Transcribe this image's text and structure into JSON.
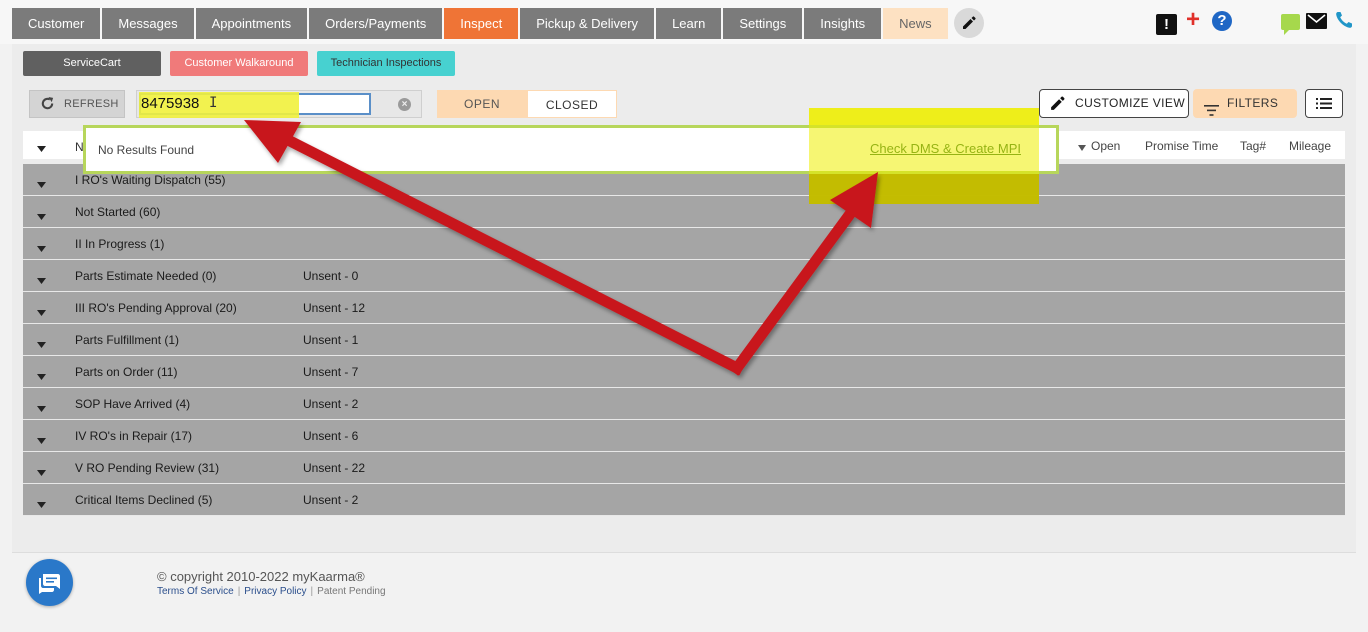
{
  "nav": {
    "tabs": [
      {
        "label": "Customer"
      },
      {
        "label": "Messages"
      },
      {
        "label": "Appointments"
      },
      {
        "label": "Orders/Payments"
      },
      {
        "label": "Inspect"
      },
      {
        "label": "Pickup & Delivery"
      },
      {
        "label": "Learn"
      },
      {
        "label": "Settings"
      },
      {
        "label": "Insights"
      },
      {
        "label": "News"
      }
    ],
    "active_tab": "Inspect",
    "alert_glyph": "!",
    "plus_glyph": "+",
    "help_glyph": "?"
  },
  "subtabs": {
    "service_cart": "ServiceCart",
    "customer_walkaround": "Customer Walkaround",
    "technician_inspections": "Technician Inspections"
  },
  "toolbar": {
    "refresh_label": "REFRESH",
    "search_value": "8475938",
    "open_label": "OPEN",
    "closed_label": "CLOSED",
    "customize_label": "CUSTOMIZE VIEW",
    "filters_label": "FILTERS"
  },
  "dropdown": {
    "no_results": "No Results Found",
    "check_link": "Check DMS & Create MPI"
  },
  "table": {
    "first_col_fragment": "N",
    "headers": {
      "open": "Open",
      "promise_time": "Promise Time",
      "tag": "Tag#",
      "mileage": "Mileage"
    },
    "groups": [
      {
        "label": "I RO's Waiting Dispatch (55)",
        "unsent": ""
      },
      {
        "label": "Not Started (60)",
        "unsent": ""
      },
      {
        "label": "II In Progress (1)",
        "unsent": ""
      },
      {
        "label": "Parts Estimate Needed (0)",
        "unsent": "Unsent - 0"
      },
      {
        "label": "III RO's Pending Approval (20)",
        "unsent": "Unsent - 12"
      },
      {
        "label": "Parts Fulfillment (1)",
        "unsent": "Unsent - 1"
      },
      {
        "label": "Parts on Order (11)",
        "unsent": "Unsent - 7"
      },
      {
        "label": "SOP Have Arrived (4)",
        "unsent": "Unsent - 2"
      },
      {
        "label": "IV RO's in Repair (17)",
        "unsent": "Unsent - 6"
      },
      {
        "label": "V RO Pending Review (31)",
        "unsent": "Unsent - 22"
      },
      {
        "label": "Critical Items Declined (5)",
        "unsent": "Unsent - 2"
      }
    ]
  },
  "footer": {
    "copyright": "© copyright 2010-2022 myKaarma®",
    "terms": "Terms Of Service",
    "privacy": "Privacy Policy",
    "patent": "Patent Pending",
    "separator": "|"
  },
  "colors": {
    "nav_tab": "#7b7b7b",
    "nav_active": "#ef7436",
    "news_tab": "#fde1c2",
    "row_bg": "#a5a5a5",
    "highlight_yellow": "#eeee00",
    "arrow_red": "#c8171c",
    "dropdown_border": "#b7d65b"
  },
  "icons": [
    "pencil-icon",
    "alert-icon",
    "plus-icon",
    "help-icon",
    "sms-icon",
    "mail-icon",
    "phone-icon",
    "refresh-icon",
    "clear-icon",
    "filter-icon",
    "list-icon",
    "caret-down-icon",
    "chat-bubble-icon"
  ]
}
